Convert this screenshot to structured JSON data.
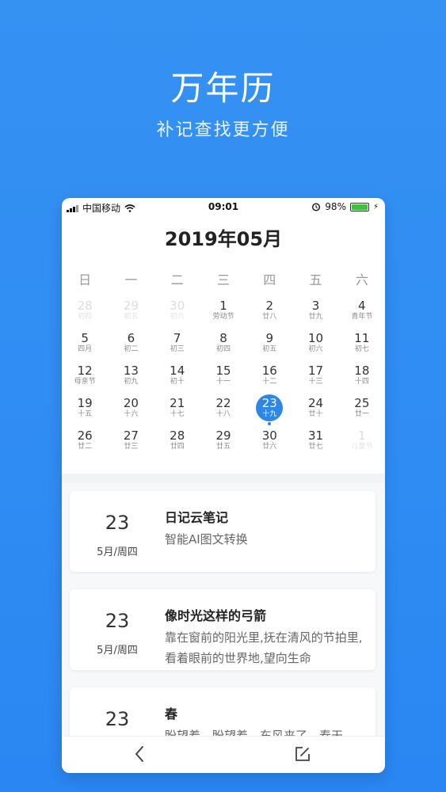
{
  "hero": {
    "title": "万年历",
    "subtitle": "补记查找更方便"
  },
  "status": {
    "carrier": "中国移动",
    "time": "09:01",
    "battery": "98%"
  },
  "calendar": {
    "title": "2019年05月",
    "weekdays": [
      "日",
      "一",
      "二",
      "三",
      "四",
      "五",
      "六"
    ],
    "weeks": [
      [
        {
          "d": "28",
          "l": "初四",
          "m": true
        },
        {
          "d": "29",
          "l": "初五",
          "m": true
        },
        {
          "d": "30",
          "l": "初六",
          "m": true
        },
        {
          "d": "1",
          "l": "劳动节"
        },
        {
          "d": "2",
          "l": "廿八"
        },
        {
          "d": "3",
          "l": "廿九"
        },
        {
          "d": "4",
          "l": "青年节"
        }
      ],
      [
        {
          "d": "5",
          "l": "四月"
        },
        {
          "d": "6",
          "l": "初二"
        },
        {
          "d": "7",
          "l": "初三"
        },
        {
          "d": "8",
          "l": "初四"
        },
        {
          "d": "9",
          "l": "初五"
        },
        {
          "d": "10",
          "l": "初六"
        },
        {
          "d": "11",
          "l": "初七"
        }
      ],
      [
        {
          "d": "12",
          "l": "母亲节"
        },
        {
          "d": "13",
          "l": "初九"
        },
        {
          "d": "14",
          "l": "初十"
        },
        {
          "d": "15",
          "l": "十一"
        },
        {
          "d": "16",
          "l": "十二"
        },
        {
          "d": "17",
          "l": "十三"
        },
        {
          "d": "18",
          "l": "十四"
        }
      ],
      [
        {
          "d": "19",
          "l": "十五"
        },
        {
          "d": "20",
          "l": "十六"
        },
        {
          "d": "21",
          "l": "十七"
        },
        {
          "d": "22",
          "l": "十八"
        },
        {
          "d": "23",
          "l": "十九",
          "s": true
        },
        {
          "d": "24",
          "l": "廿十"
        },
        {
          "d": "25",
          "l": "廿一"
        }
      ],
      [
        {
          "d": "26",
          "l": "廿二"
        },
        {
          "d": "27",
          "l": "廿三"
        },
        {
          "d": "28",
          "l": "廿四"
        },
        {
          "d": "29",
          "l": "廿五"
        },
        {
          "d": "30",
          "l": "廿六"
        },
        {
          "d": "31",
          "l": "廿七"
        },
        {
          "d": "1",
          "l": "儿童节",
          "m": true
        }
      ]
    ]
  },
  "entries": [
    {
      "day": "23",
      "md": "5月/周四",
      "title": "日记云笔记",
      "body": "智能AI图文转换"
    },
    {
      "day": "23",
      "md": "5月/周四",
      "title": "像时光这样的弓箭",
      "body": "靠在窗前的阳光里,抚在清风的节拍里,看着眼前的世界地,望向生命"
    },
    {
      "day": "23",
      "md": "",
      "title": "春",
      "body": "盼望着，盼望着，东风来了，春天"
    }
  ],
  "icons": {
    "back": "chevron-left-icon",
    "edit": "edit-icon"
  },
  "colors": {
    "background": "#3591f2",
    "accent": "#2e86e6"
  }
}
